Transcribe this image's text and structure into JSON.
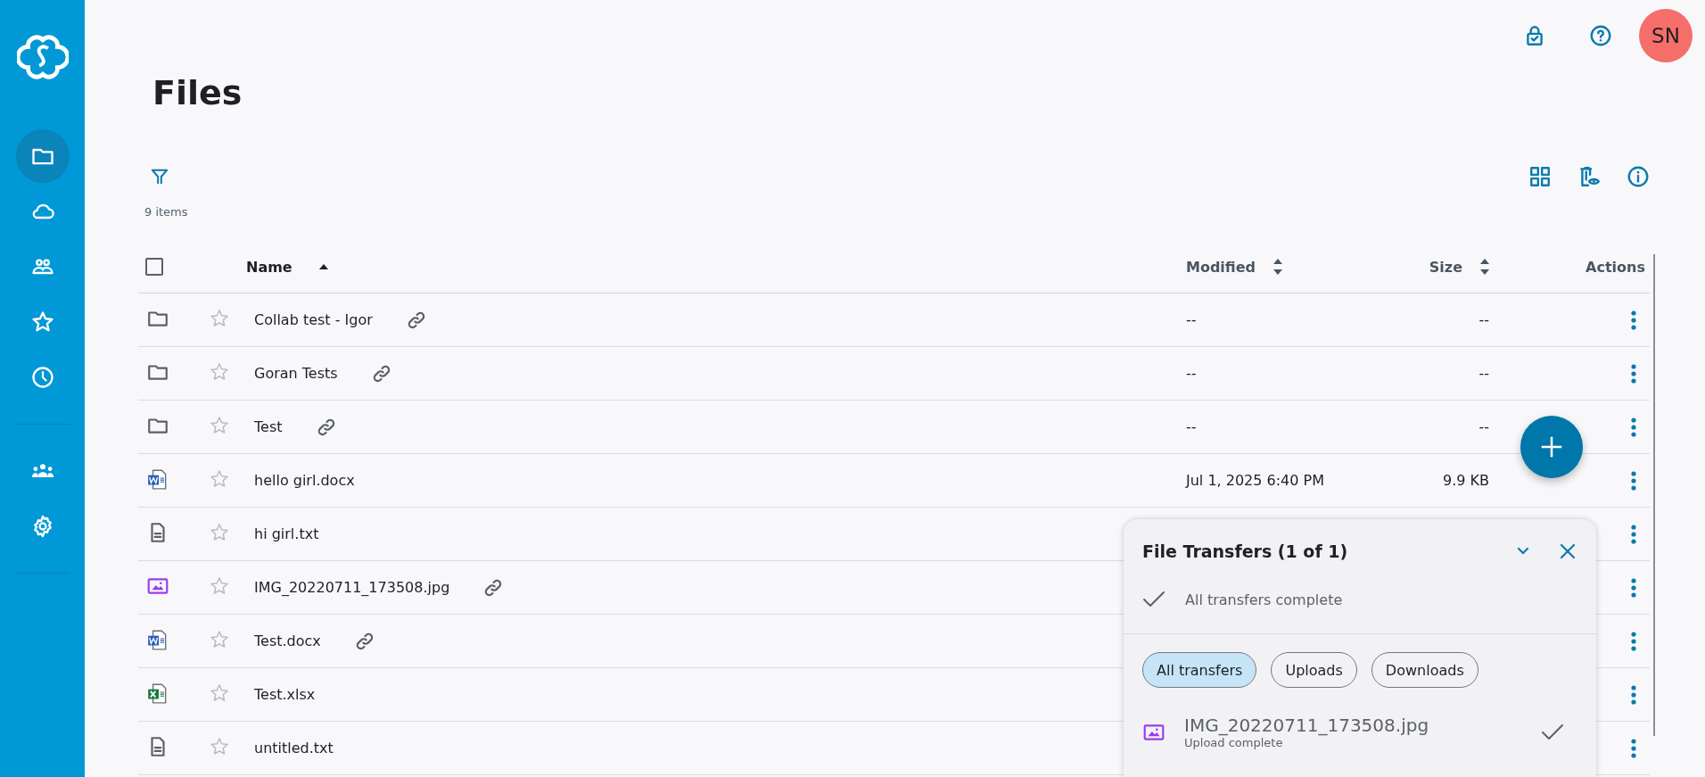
{
  "sidebar": {
    "items": [
      {
        "kind": "folder",
        "selected": true
      },
      {
        "kind": "cloud",
        "selected": false
      },
      {
        "kind": "shared",
        "selected": false
      },
      {
        "kind": "star",
        "selected": false
      },
      {
        "kind": "recent",
        "selected": false
      },
      {
        "kind": "divider"
      },
      {
        "kind": "users",
        "selected": false
      },
      {
        "kind": "settings",
        "selected": false
      },
      {
        "kind": "divider"
      }
    ]
  },
  "header": {
    "avatar": {
      "initials": "SN"
    }
  },
  "page": {
    "title": "Files",
    "item_count": "9 items"
  },
  "table": {
    "select_all": {
      "checked": false
    },
    "columns": [
      {
        "label": "Name",
        "sorted": true,
        "descending": false
      },
      {
        "label": "Modified",
        "sorted": false
      },
      {
        "label": "Size",
        "sorted": false
      },
      {
        "label": "Actions"
      }
    ],
    "rows": [
      {
        "kind": "folder",
        "name": "Collab test - Igor",
        "starred": false,
        "shared": true,
        "modified": "--",
        "size": "--"
      },
      {
        "kind": "folder",
        "name": "Goran Tests",
        "starred": false,
        "shared": true,
        "modified": "--",
        "size": "--"
      },
      {
        "kind": "folder",
        "name": "Test",
        "starred": false,
        "shared": true,
        "modified": "--",
        "size": "--"
      },
      {
        "kind": "word",
        "name": "hello girl.docx",
        "starred": false,
        "shared": false,
        "modified": "Jul 1, 2025 6:40 PM",
        "size": "9.9 KB"
      },
      {
        "kind": "text",
        "name": "hi girl.txt",
        "starred": false,
        "shared": false
      },
      {
        "kind": "image",
        "name": "IMG_20220711_173508.jpg",
        "starred": false,
        "shared": true
      },
      {
        "kind": "word",
        "name": "Test.docx",
        "starred": false,
        "shared": true
      },
      {
        "kind": "excel",
        "name": "Test.xlsx",
        "starred": false,
        "shared": false
      },
      {
        "kind": "text",
        "name": "untitled.txt",
        "starred": false,
        "shared": false
      }
    ]
  },
  "transfers": {
    "title": "File Transfers (1 of 1)",
    "status": "All transfers complete",
    "filters": [
      {
        "label": "All transfers",
        "selected": true
      },
      {
        "label": "Uploads",
        "selected": false
      },
      {
        "label": "Downloads",
        "selected": false
      }
    ],
    "items": [
      {
        "kind": "image",
        "name": "IMG_20220711_173508.jpg",
        "status": "Upload complete",
        "done": true
      }
    ]
  }
}
